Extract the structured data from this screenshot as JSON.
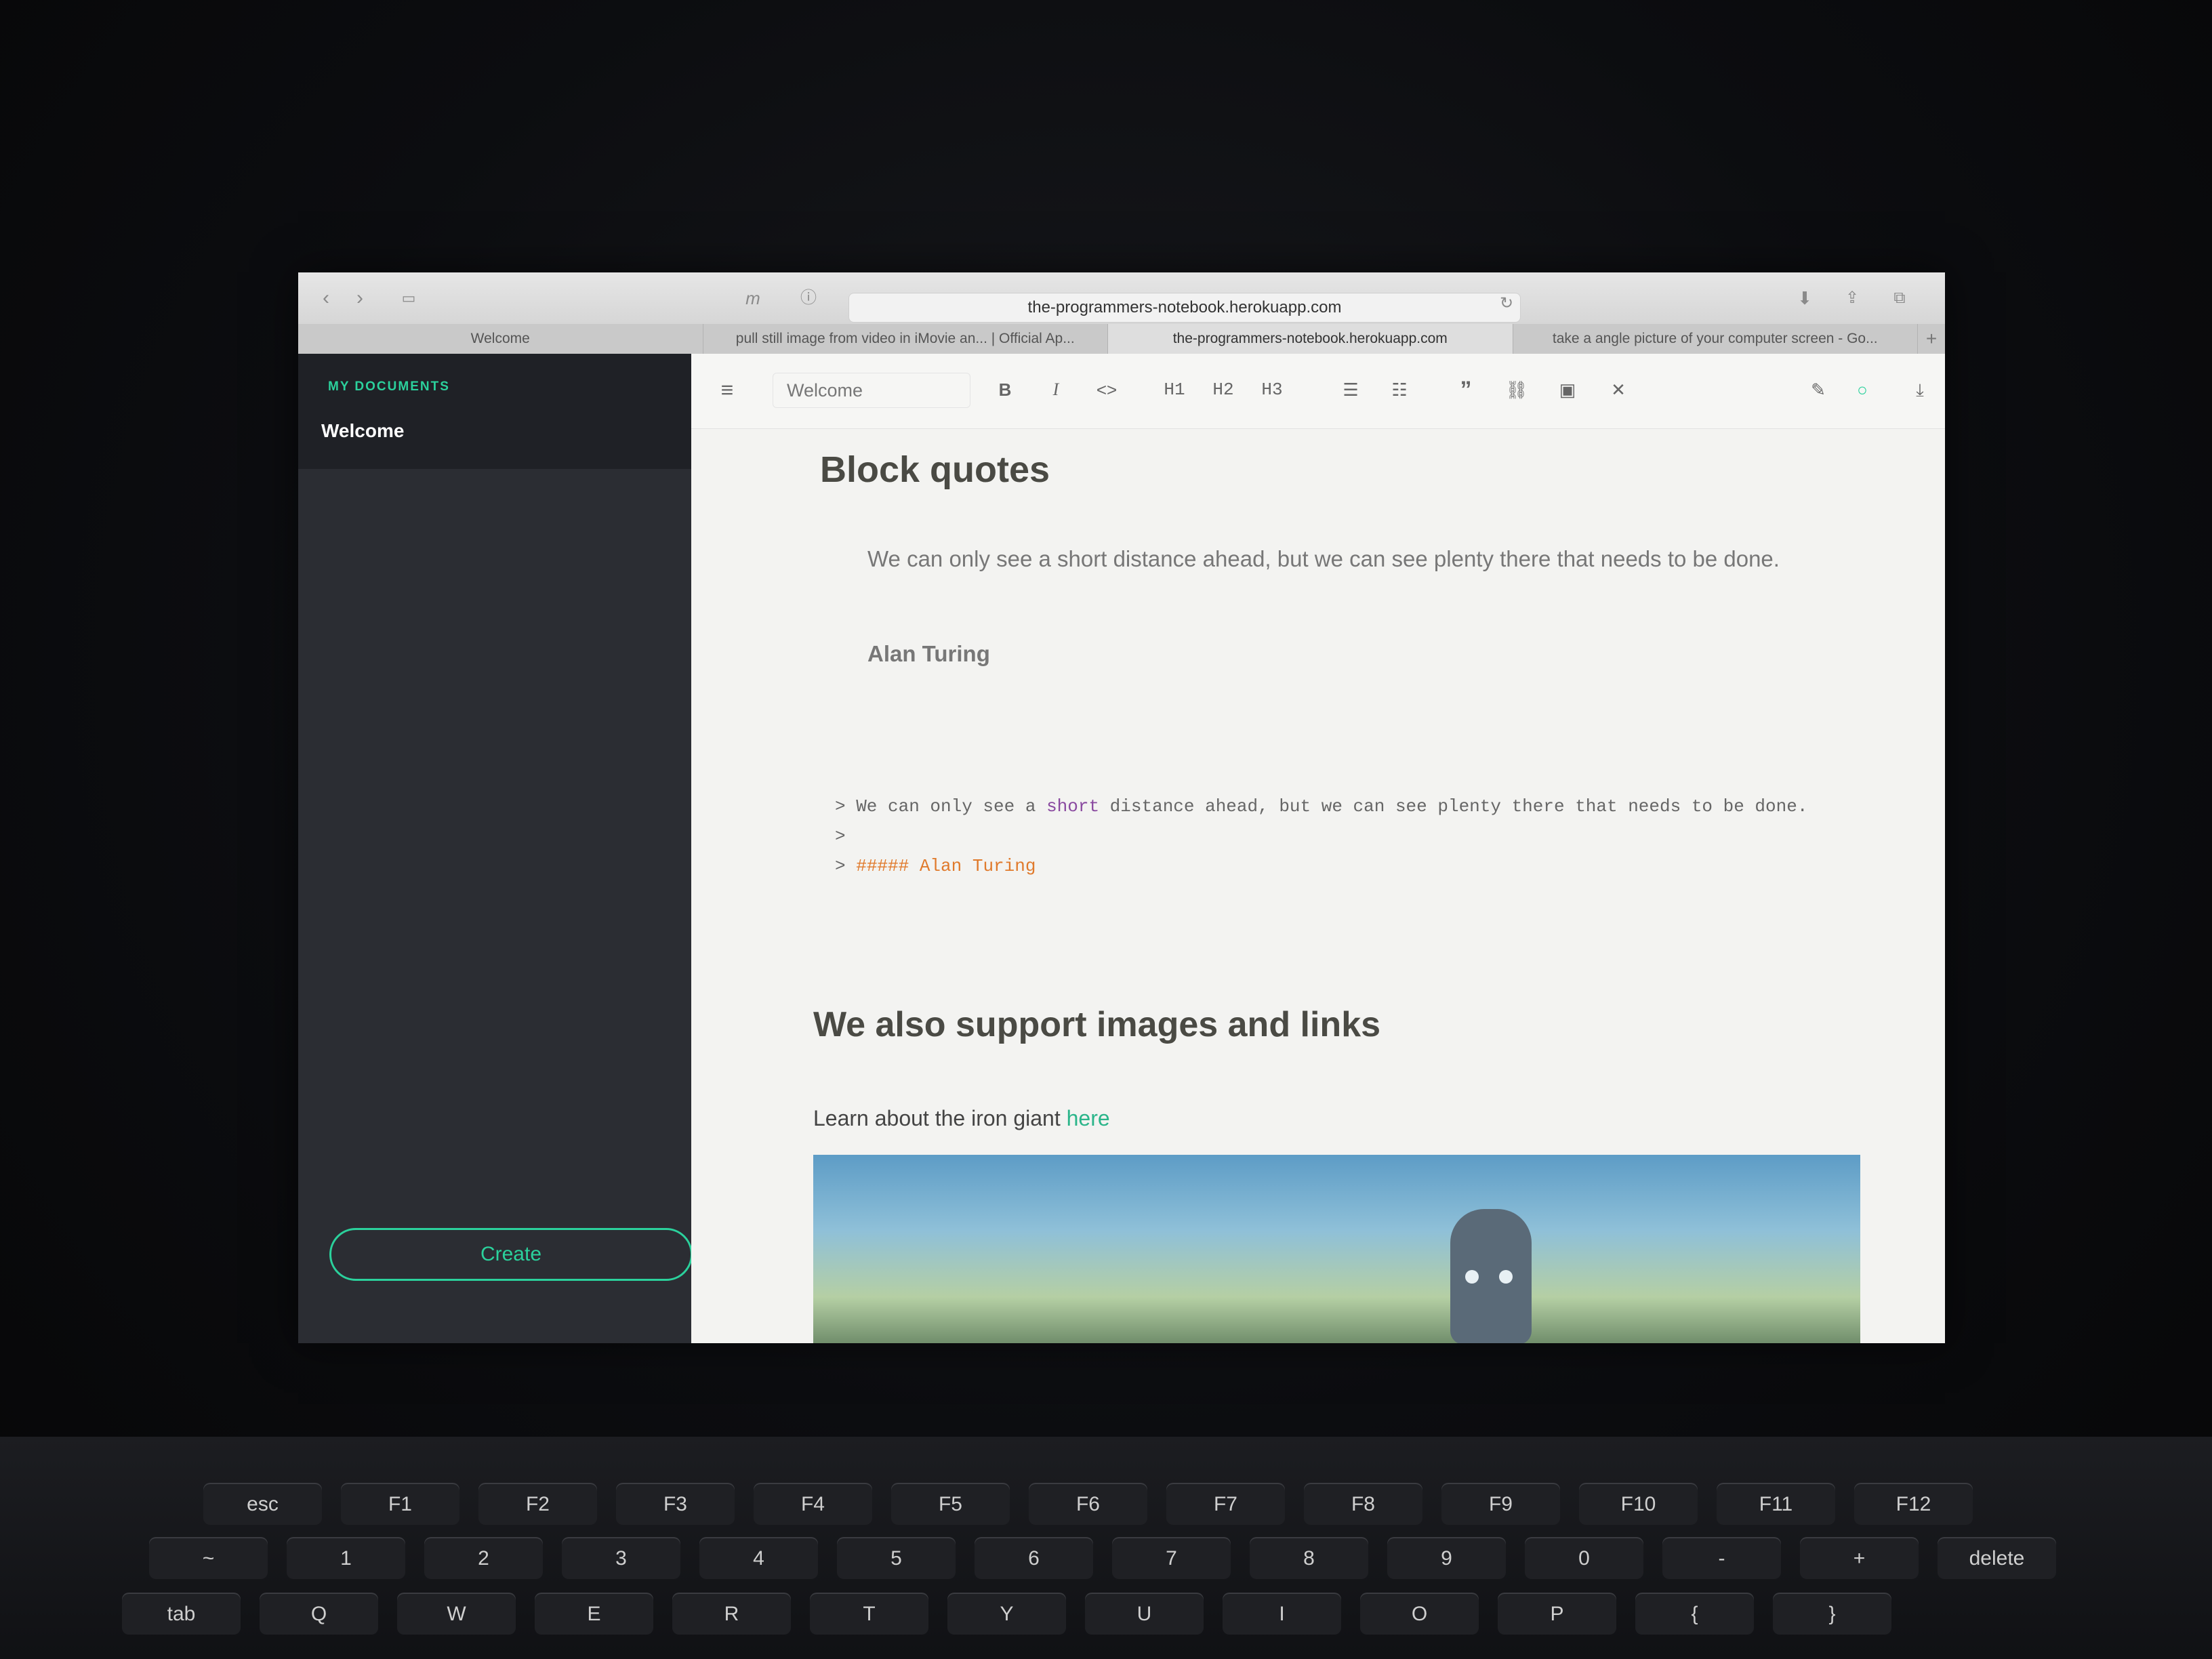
{
  "browser": {
    "url": "the-programmers-notebook.herokuapp.com",
    "tabs": [
      {
        "label": "Welcome",
        "active": false
      },
      {
        "label": "pull still image from video in iMovie an... | Official Ap...",
        "active": false
      },
      {
        "label": "the-programmers-notebook.herokuapp.com",
        "active": true
      },
      {
        "label": "take a angle picture of your computer screen - Go...",
        "active": false
      }
    ],
    "new_tab": "+"
  },
  "sidebar": {
    "title": "MY DOCUMENTS",
    "documents": [
      "Welcome"
    ],
    "create_label": "Create"
  },
  "editor_toolbar": {
    "doc_name": "Welcome",
    "buttons": {
      "bold": "B",
      "italic": "I",
      "code": "<>",
      "h1": "H1",
      "h2": "H2",
      "h3": "H3",
      "quote": "”"
    }
  },
  "content": {
    "heading_blockquotes": "Block quotes",
    "quote_text": "We can only see a short distance ahead, but we can see plenty there that needs to be done.",
    "quote_author": "Alan Turing",
    "code_lines": {
      "line1_a": "> We can only see a ",
      "line1_kw": "short",
      "line1_b": " distance ahead, but we can see plenty there that needs to be done.",
      "line2": ">",
      "line3_a": "> ",
      "line3_h": "##### Alan Turing"
    },
    "heading_images": "We also support images and links",
    "para_text": "Learn about the iron giant ",
    "para_link": "here"
  },
  "keyboard": {
    "row1": [
      "esc",
      "F1",
      "F2",
      "F3",
      "F4",
      "F5",
      "F6",
      "F7",
      "F8",
      "F9",
      "F10",
      "F11",
      "F12"
    ],
    "row2": [
      "~",
      "1",
      "2",
      "3",
      "4",
      "5",
      "6",
      "7",
      "8",
      "9",
      "0",
      "-",
      "+",
      "delete"
    ],
    "row3": [
      "tab",
      "Q",
      "W",
      "E",
      "R",
      "T",
      "Y",
      "U",
      "I",
      "O",
      "P",
      "{",
      "}"
    ]
  },
  "colors": {
    "accent": "#2bd19c",
    "sidebar_bg": "#2b2d33",
    "link": "#2bb58a"
  }
}
